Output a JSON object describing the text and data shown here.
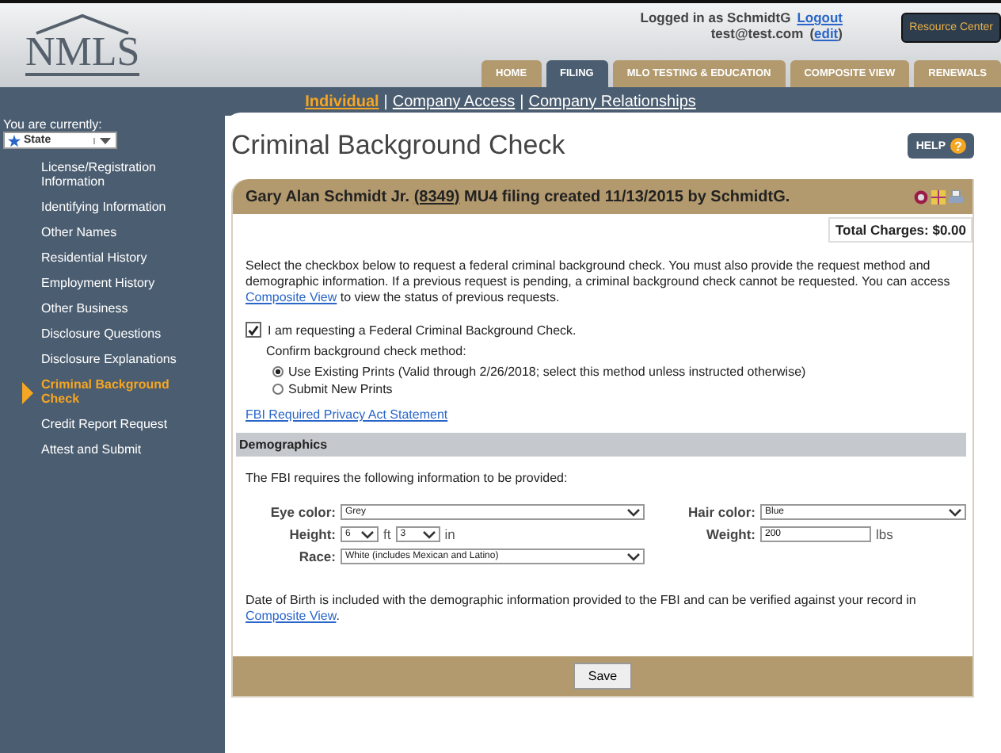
{
  "header": {
    "logo": "NMLS",
    "logged_in": "Logged in as SchmidtG",
    "logout": "Logout",
    "email": "test@test.com",
    "edit_open": "(",
    "edit": "edit",
    "edit_close": ")",
    "resource_button": "Resource Center"
  },
  "tabs": [
    {
      "label": "HOME",
      "selected": false
    },
    {
      "label": "FILING",
      "selected": true
    },
    {
      "label": "MLO TESTING & EDUCATION",
      "selected": false
    },
    {
      "label": "COMPOSITE VIEW",
      "selected": false
    },
    {
      "label": "RENEWALS",
      "selected": false
    }
  ],
  "subnav_separator": "|",
  "subnav": [
    {
      "label": "Individual",
      "selected": true
    },
    {
      "label": "Company Access",
      "selected": false
    },
    {
      "label": "Company Relationships",
      "selected": false
    }
  ],
  "sidebar": {
    "caption": "You are currently:",
    "role": "State",
    "items": [
      {
        "label": "License/Registration Information",
        "selected": false
      },
      {
        "label": "Identifying Information",
        "selected": false
      },
      {
        "label": "Other Names",
        "selected": false
      },
      {
        "label": "Residential History",
        "selected": false
      },
      {
        "label": "Employment History",
        "selected": false
      },
      {
        "label": "Other Business",
        "selected": false
      },
      {
        "label": "Disclosure Questions",
        "selected": false
      },
      {
        "label": "Disclosure Explanations",
        "selected": false
      },
      {
        "label": "Criminal Background Check",
        "selected": true
      },
      {
        "label": "Credit Report Request",
        "selected": false
      },
      {
        "label": "Attest and Submit",
        "selected": false
      }
    ]
  },
  "page_title": "Criminal Background Check",
  "help": {
    "label": "HELP",
    "icon": "?"
  },
  "filing": {
    "name": "Gary Alan Schmidt Jr.",
    "id": "(8349)",
    "description": "MU4 filing created 11/13/2015 by SchmidtG.",
    "total": "Total Charges: $0.00"
  },
  "intro": {
    "before": "Select the checkbox below to request a federal criminal background check. You must also provide the request method and demographic information. If a previous request is pending, a criminal background check cannot be requested. You can access ",
    "link": "Composite View",
    "after": " to view the status of previous requests."
  },
  "request": {
    "label": "I am requesting a Federal Criminal Background Check.",
    "checked": true
  },
  "method_label": "Confirm background check method:",
  "methods": [
    {
      "label": "Use Existing Prints (Valid through 2/26/2018; select this method unless instructed otherwise)",
      "selected": true
    },
    {
      "label": "Submit New Prints",
      "selected": false
    }
  ],
  "privacy_link": "FBI Required Privacy Act Statement",
  "demographics": {
    "heading": "Demographics",
    "intro": "The FBI requires the following information to be provided:",
    "eye_label": "Eye color:",
    "eye": "Grey",
    "hair_label": "Hair color:",
    "hair": "Blue",
    "height_label": "Height:",
    "feet": "6",
    "ft": "ft",
    "inches": "3",
    "in": "in",
    "weight_label": "Weight:",
    "weight": "200",
    "lbs": "lbs",
    "race_label": "Race:",
    "race": "White (includes Mexican and Latino)"
  },
  "dob_note": {
    "before": "Date of Birth is included with the demographic information provided to the FBI and can be verified against your record in ",
    "link": "Composite View",
    "after": "."
  },
  "save": "Save"
}
